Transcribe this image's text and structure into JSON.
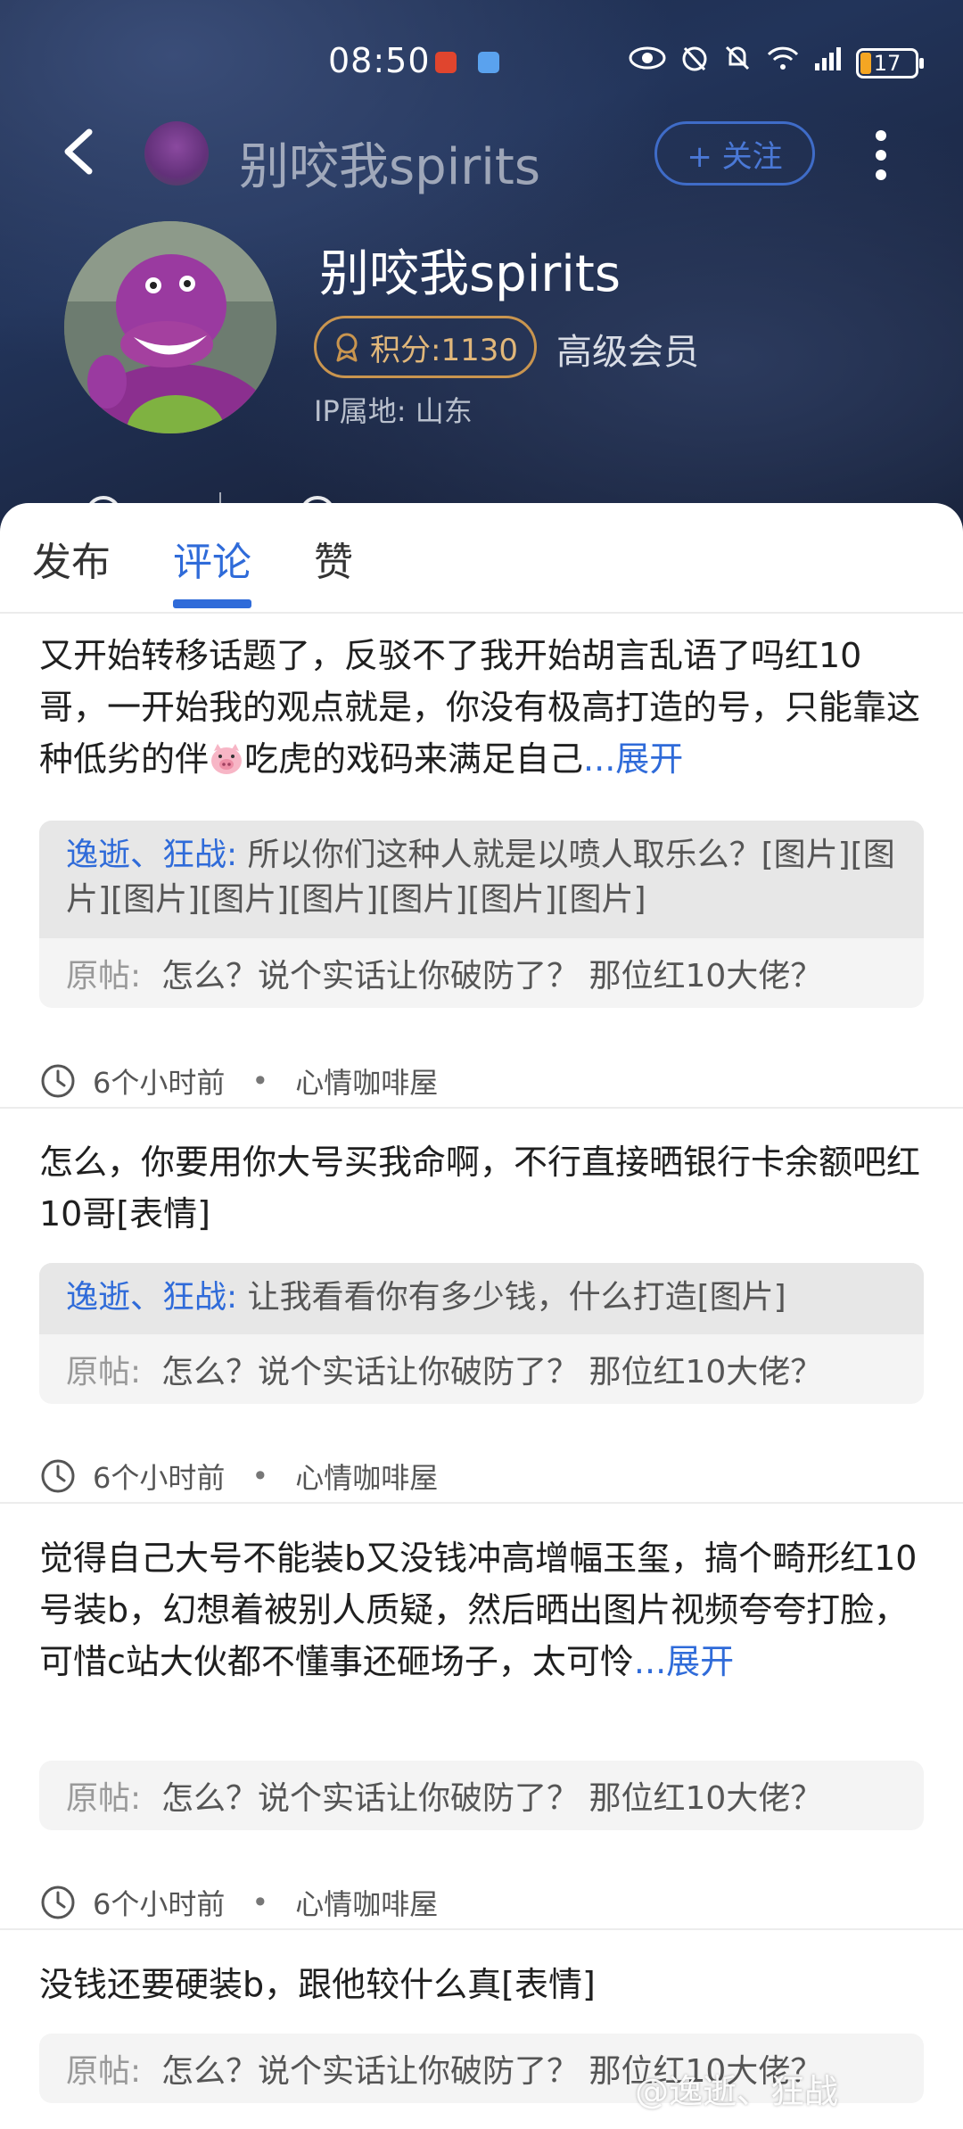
{
  "status_bar": {
    "time": "08:50",
    "battery": "17",
    "icons": [
      "eye-icon",
      "alarm-icon",
      "mute-icon",
      "wifi-icon",
      "4g-signal-icon"
    ]
  },
  "nav": {
    "title": "别咬我spirits",
    "follow_label": "+ 关注"
  },
  "profile": {
    "name": "别咬我spirits",
    "points": "积分:1130",
    "level": "高级会员",
    "ip": "IP属地: 山东"
  },
  "tabs": [
    {
      "label": "发布",
      "active": false
    },
    {
      "label": "评论",
      "active": true
    },
    {
      "label": "赞",
      "active": false
    }
  ],
  "posts": [
    {
      "text": "又开始转移话题了，反驳不了我开始胡言乱语了吗红10哥，一开始我的观点就是，你没有极高打造的号，只能靠这种低劣的伴",
      "text_after_emoji": "吃虎的戏码来满足自己",
      "expand": "...展开",
      "reply_user": "逸逝、狂战:",
      "reply_text": "所以你们这种人就是以喷人取乐么？[图片][图片][图片][图片][图片][图片][图片][图片]",
      "orig_label": "原帖:",
      "orig_text": "怎么？说个实话让你破防了？ 那位红10大佬？",
      "time": "6个小时前",
      "dot": "•",
      "forum": "心情咖啡屋"
    },
    {
      "text": "怎么，你要用你大号买我命啊，不行直接晒银行卡余额吧红10哥[表情]",
      "reply_user": "逸逝、狂战:",
      "reply_text": "让我看看你有多少钱，什么打造[图片]",
      "orig_label": "原帖:",
      "orig_text": "怎么？说个实话让你破防了？ 那位红10大佬？",
      "time": "6个小时前",
      "dot": "•",
      "forum": "心情咖啡屋"
    },
    {
      "text": "觉得自己大号不能装b又没钱冲高增幅玉玺，搞个畸形红10号装b，幻想着被别人质疑，然后晒出图片视频夸夸打脸，可惜c站大伙都不懂事还砸场子，太可怜",
      "expand": "...展开",
      "orig_label": "原帖:",
      "orig_text": "怎么？说个实话让你破防了？ 那位红10大佬？",
      "time": "6个小时前",
      "dot": "•",
      "forum": "心情咖啡屋"
    },
    {
      "text": "没钱还要硬装b，跟他较什么真[表情]",
      "orig_label": "原帖:",
      "orig_text": "怎么？说个实话让你破防了？ 那位红10大佬？"
    }
  ],
  "watermark": "@逸逝、狂战",
  "colors": {
    "accent": "#2f6bd9",
    "header_bg": "#1c2a48",
    "badge_gold": "#c9954f"
  }
}
